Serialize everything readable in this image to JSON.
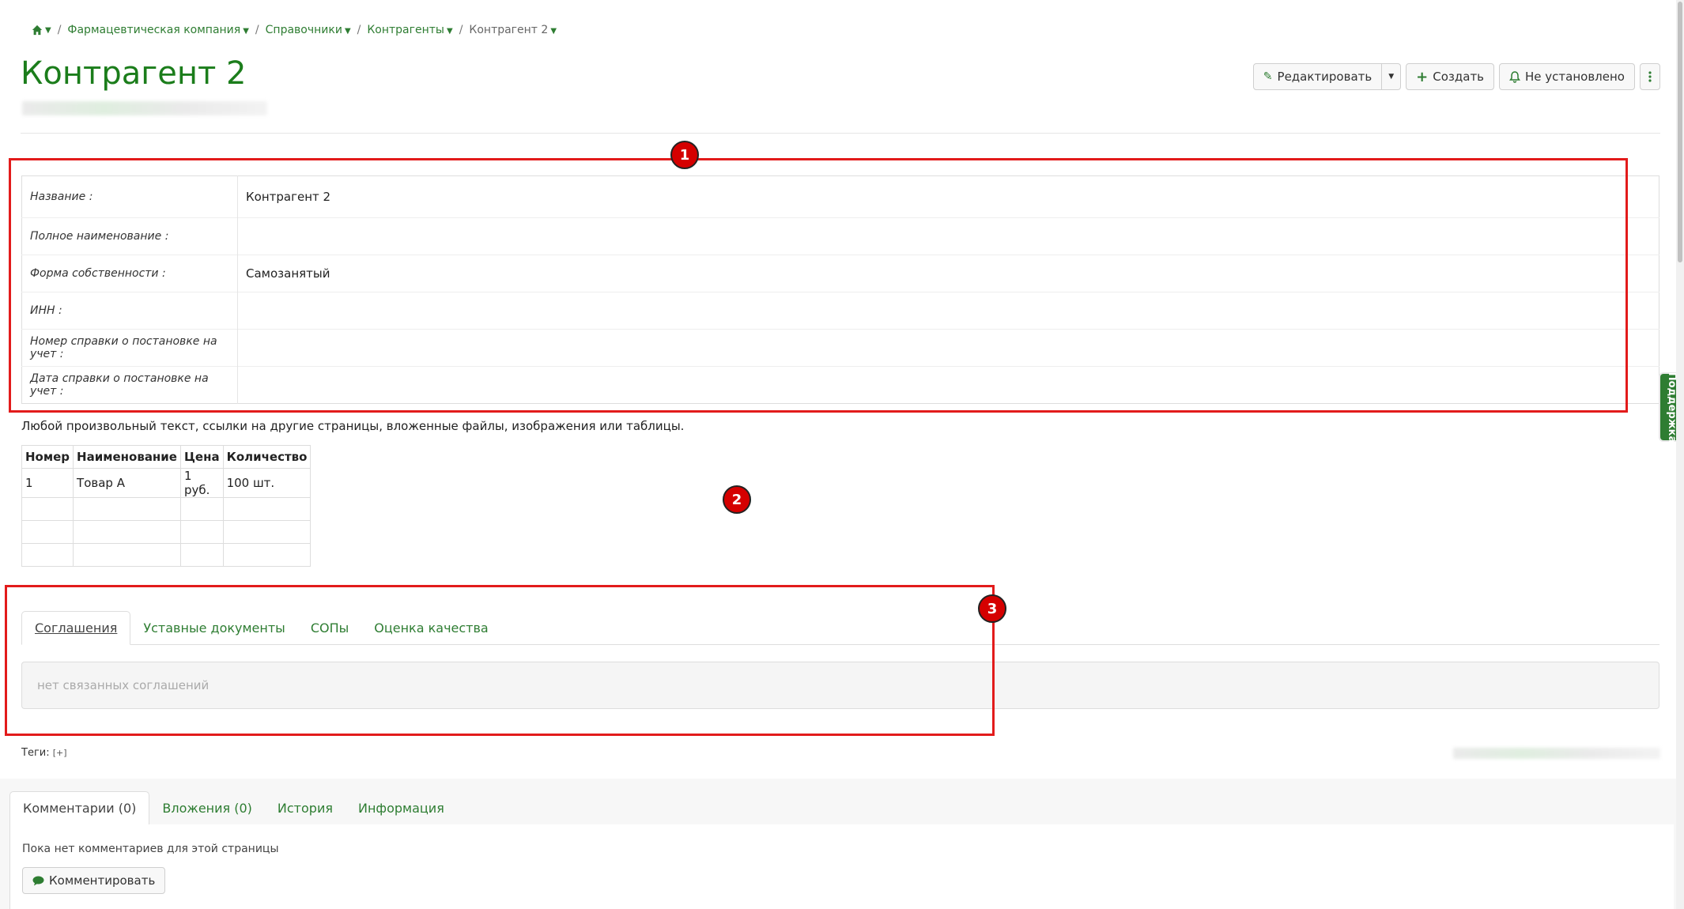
{
  "breadcrumb": {
    "items": [
      "Фармацевтическая компания",
      "Справочники",
      "Контрагенты"
    ],
    "current": "Контрагент 2"
  },
  "page": {
    "title": "Контрагент 2"
  },
  "toolbar": {
    "edit_label": "Редактировать",
    "create_label": "Создать",
    "notify_label": "Не установлено"
  },
  "properties": [
    {
      "label": "Название :",
      "value": "Контрагент 2"
    },
    {
      "label": "Полное наименование :",
      "value": ""
    },
    {
      "label": "Форма собственности :",
      "value": "Самозанятый"
    },
    {
      "label": "ИНН :",
      "value": ""
    },
    {
      "label": "Номер справки о постановке на учет :",
      "value": ""
    },
    {
      "label": "Дата справки о постановке на учет :",
      "value": ""
    }
  ],
  "free_text": "Любой произвольный текст, ссылки на другие страницы, вложенные файлы, изображения или таблицы.",
  "items_table": {
    "headers": [
      "Номер",
      "Наименование",
      "Цена",
      "Количество"
    ],
    "rows": [
      [
        "1",
        "Товар А",
        "1 руб.",
        "100 шт."
      ],
      [
        "",
        "",
        "",
        ""
      ],
      [
        "",
        "",
        "",
        ""
      ],
      [
        "",
        "",
        "",
        ""
      ]
    ]
  },
  "annotations": [
    "1",
    "2",
    "3"
  ],
  "relation_tabs": [
    "Соглашения",
    "Уставные документы",
    "СОПы",
    "Оценка качества"
  ],
  "relation_empty": "нет связанных соглашений",
  "tags": {
    "label": "Теги:",
    "add": "[+]"
  },
  "bottom_tabs": [
    "Комментарии (0)",
    "Вложения (0)",
    "История",
    "Информация"
  ],
  "comments": {
    "empty": "Пока нет комментариев для этой страницы",
    "button": "Комментировать"
  },
  "support": {
    "label": "Поддержка"
  },
  "colors": {
    "accent": "#2e7d32",
    "annotation": "#e21b1b"
  }
}
